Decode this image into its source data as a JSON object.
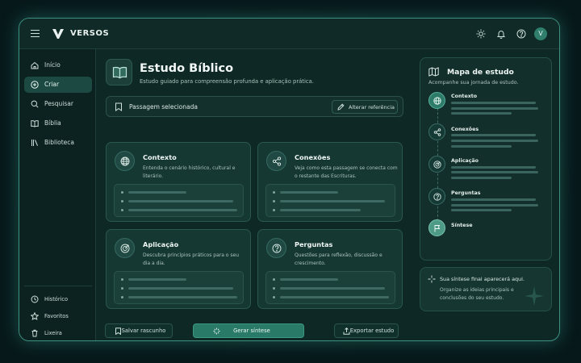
{
  "app": {
    "brand": "VERSOS",
    "avatar_initial": "V"
  },
  "topbar": {
    "icons": [
      "menu-icon",
      "sun-icon",
      "bell-icon",
      "help-icon"
    ]
  },
  "sidebar": {
    "items": [
      {
        "label": "Início",
        "icon": "home-icon",
        "active": false
      },
      {
        "label": "Criar",
        "icon": "plus-circle-icon",
        "active": true
      },
      {
        "label": "Pesquisar",
        "icon": "search-icon",
        "active": false
      },
      {
        "label": "Bíblia",
        "icon": "book-open-icon",
        "active": false
      },
      {
        "label": "Biblioteca",
        "icon": "library-icon",
        "active": false
      }
    ],
    "bottom": [
      {
        "label": "Histórico",
        "icon": "clock-icon"
      },
      {
        "label": "Favoritos",
        "icon": "star-icon"
      },
      {
        "label": "Lixeira",
        "icon": "trash-icon"
      }
    ]
  },
  "main": {
    "title": "Estudo Bíblico",
    "subtitle": "Estudo guiado para compreensão profunda e aplicação prática.",
    "passage": {
      "label": "Passagem selecionada",
      "button": "Alterar referência"
    },
    "cards": [
      {
        "title": "Contexto",
        "desc": "Entenda o cenário histórico, cultural e literário.",
        "icon": "globe-icon"
      },
      {
        "title": "Conexões",
        "desc": "Veja como esta passagem se conecta com o restante das Escrituras.",
        "icon": "share-icon"
      },
      {
        "title": "Aplicação",
        "desc": "Descubra princípios práticos para o seu dia a dia.",
        "icon": "target-icon"
      },
      {
        "title": "Perguntas",
        "desc": "Questões para reflexão, discussão e crescimento.",
        "icon": "question-icon"
      }
    ],
    "actions": {
      "save": "Salvar rascunho",
      "generate": "Gerar síntese",
      "export": "Exportar estudo"
    }
  },
  "study_map": {
    "title": "Mapa de estudo",
    "subtitle": "Acompanhe sua jornada de estudo.",
    "steps": [
      {
        "label": "Contexto",
        "icon": "globe-icon"
      },
      {
        "label": "Conexões",
        "icon": "share-icon"
      },
      {
        "label": "Aplicação",
        "icon": "target-icon"
      },
      {
        "label": "Perguntas",
        "icon": "question-icon"
      },
      {
        "label": "Síntese",
        "icon": "flag-icon"
      }
    ],
    "note": {
      "title": "Sua síntese final aparecerá aqui.",
      "text": "Organize as ideias principais e conclusões do seu estudo."
    }
  },
  "colors": {
    "accent": "#2a7a68",
    "border_glow": "#3e8f80",
    "background": "#0e2825"
  }
}
